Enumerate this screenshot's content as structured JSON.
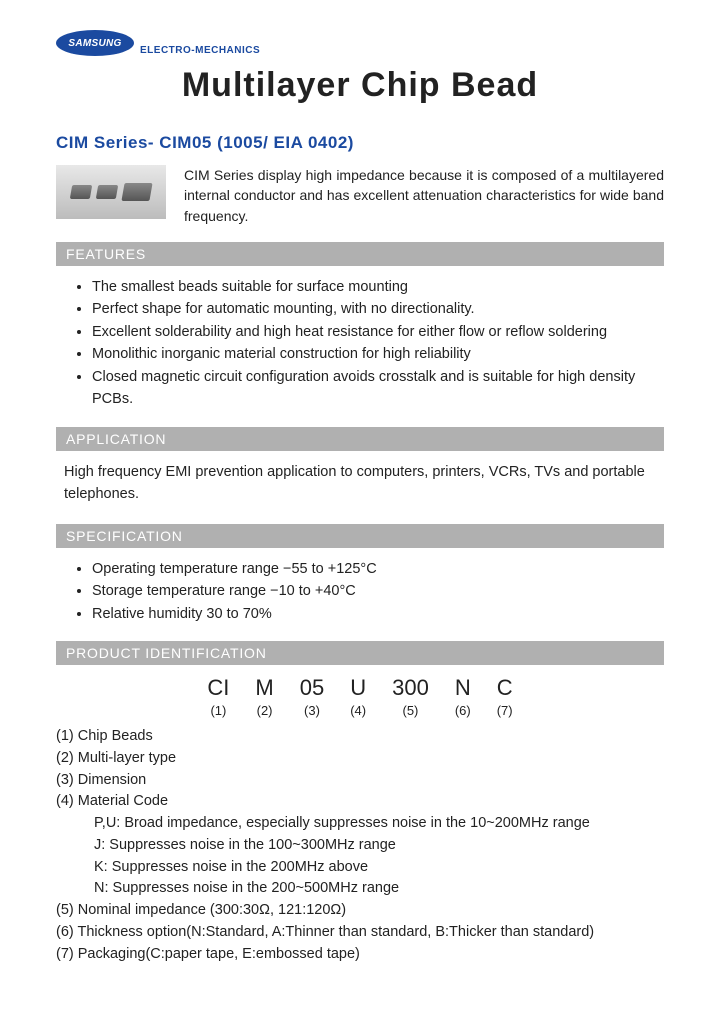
{
  "logo": {
    "brand": "SAMSUNG",
    "division": "ELECTRO-MECHANICS"
  },
  "title": "Multilayer Chip Bead",
  "subtitle": "CIM Series- CIM05 (1005/ EIA 0402)",
  "intro": "CIM Series display high impedance because it is composed of a multilayered internal conductor and has excellent attenuation characteristics for wide band frequency.",
  "sections": {
    "features": {
      "header": "FEATURES",
      "items": [
        "The smallest beads suitable for surface mounting",
        "Perfect shape for automatic mounting, with no directionality.",
        "Excellent solderability and high heat resistance for either flow or reflow soldering",
        "Monolithic inorganic material construction for high reliability",
        "Closed magnetic circuit configuration avoids crosstalk and is suitable for high density PCBs."
      ]
    },
    "application": {
      "header": "APPLICATION",
      "text": "High frequency EMI prevention application to computers, printers, VCRs, TVs and portable telephones."
    },
    "specification": {
      "header": "SPECIFICATION",
      "items": [
        "Operating temperature range −55 to +125°C",
        "Storage temperature range   −10 to +40°C",
        "Relative humidity 30 to 70%"
      ]
    },
    "product_id": {
      "header": "PRODUCT IDENTIFICATION",
      "code": [
        {
          "big": "CI",
          "small": "(1)"
        },
        {
          "big": "M",
          "small": "(2)"
        },
        {
          "big": "05",
          "small": "(3)"
        },
        {
          "big": "U",
          "small": "(4)"
        },
        {
          "big": "300",
          "small": "(5)"
        },
        {
          "big": "N",
          "small": "(6)"
        },
        {
          "big": "C",
          "small": "(7)"
        }
      ],
      "legend": [
        "(1) Chip Beads",
        "(2) Multi-layer type",
        "(3) Dimension",
        "(4) Material Code",
        "P,U: Broad impedance, especially suppresses noise in the 10~200MHz range",
        "J: Suppresses noise in the 100~300MHz range",
        "K: Suppresses noise in the 200MHz above",
        "N: Suppresses noise in the 200~500MHz range",
        "(5) Nominal impedance (300:30Ω, 121:120Ω)",
        "(6) Thickness option(N:Standard, A:Thinner than standard, B:Thicker than standard)",
        "(7) Packaging(C:paper tape, E:embossed tape)"
      ],
      "legend_indent": [
        false,
        false,
        false,
        false,
        true,
        true,
        true,
        true,
        false,
        false,
        false
      ]
    }
  }
}
